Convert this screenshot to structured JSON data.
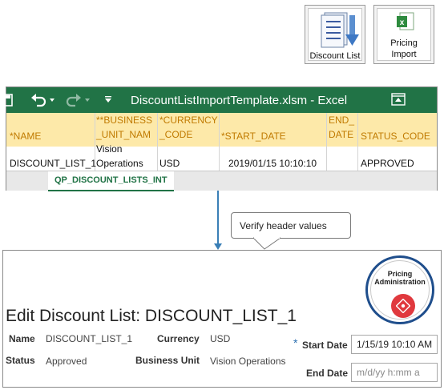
{
  "toolbar_tiles": [
    {
      "label": "Discount List",
      "icon": "discount-list-icon"
    },
    {
      "label_line1": "Pricing",
      "label_line2": "Import",
      "icon": "excel-workbook-icon"
    }
  ],
  "excel": {
    "title": "DiscountListImportTemplate.xlsm - Excel",
    "headers": [
      {
        "line1": "",
        "line2": "*NAME"
      },
      {
        "line1": "**BUSINESS",
        "line2": "_UNIT_NAM"
      },
      {
        "line1": "*CURRENCY",
        "line2": "_CODE"
      },
      {
        "line1": "",
        "line2": "*START_DATE"
      },
      {
        "line1": "END_",
        "line2": "DATE"
      },
      {
        "line1": "",
        "line2": "STATUS_CODE"
      }
    ],
    "row": {
      "name": "DISCOUNT_LIST_1",
      "bu_line1": "Vision",
      "bu_line2": "Operations",
      "currency": "USD",
      "start_date": "2019/01/15 10:10:10",
      "end_date": "",
      "status": "APPROVED"
    },
    "sheet_tab": "QP_DISCOUNT_LISTS_INT",
    "accent": "#217346",
    "header_fill": "#fde9a9"
  },
  "callout": "Verify header values",
  "oracle": {
    "badge_line1": "Pricing",
    "badge_line2": "Administration",
    "page_title": "Edit Discount List: DISCOUNT_LIST_1",
    "name_label": "Name",
    "name_value": "DISCOUNT_LIST_1",
    "currency_label": "Currency",
    "currency_value": "USD",
    "status_label": "Status",
    "status_value": "Approved",
    "bu_label": "Business Unit",
    "bu_value": "Vision Operations",
    "required_mark": "*",
    "start_label": "Start Date",
    "start_value": "1/15/19 10:10 AM",
    "end_label": "End Date",
    "end_placeholder": "m/d/yy h:mm a",
    "badge_color": "#e0393e"
  }
}
